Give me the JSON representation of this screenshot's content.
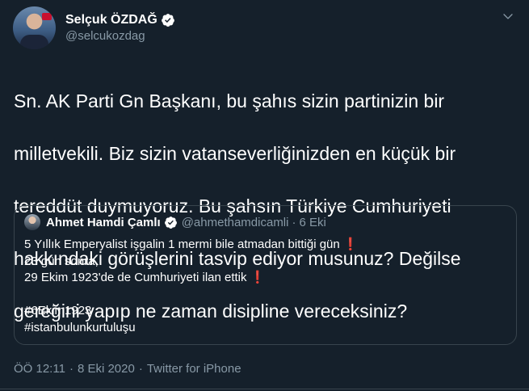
{
  "tweet": {
    "author": {
      "display_name": "Selçuk ÖZDAĞ",
      "handle": "@selcukozdag",
      "verified_icon": "verified-badge-icon",
      "avatar": "avatar"
    },
    "menu_icon": "chevron-down-icon",
    "text_lines": [
      "Sn. AK Parti Gn Başkanı, bu şahıs sizin partinizin bir",
      "milletvekili. Biz sizin vatanseverliğinizden en küçük bir",
      "tereddüt duymuyoruz. Bu şahsın Türkiye Cumhuriyeti",
      "hakkındaki görüşlerini tasvip ediyor musunuz? Değilse",
      "gereğini yapıp ne zaman disipline vereceksiniz?"
    ],
    "quoted": {
      "display_name": "Ahmet Hamdi Çamlı",
      "handle": "@ahmethamdicamli",
      "dot": "·",
      "date": "6 Eki",
      "lines": [
        {
          "text": "5 Yıllık Emperyalist işgalin 1 mermi bile atmadan bittiği gün ",
          "mark": "❗"
        },
        {
          "text": "23 gün sonra,",
          "mark": ""
        },
        {
          "text": "29 Ekim 1923'de de Cumhuriyeti ilan ettik ",
          "mark": "❗"
        },
        {
          "text": "",
          "mark": ""
        },
        {
          "text": "#6Ekim1923",
          "mark": ""
        },
        {
          "text": "#istanbulunkurtuluşu",
          "mark": ""
        }
      ]
    },
    "footer": {
      "time": "ÖÖ 12:11",
      "sep1": "·",
      "date": "8 Eki 2020",
      "sep2": "·",
      "source": "Twitter for iPhone"
    }
  },
  "colors": {
    "background": "#15202b",
    "text": "#ffffff",
    "secondary": "#8899a6",
    "border": "#38444d",
    "verified": "#ffffff",
    "red_mark": "#e0245e"
  }
}
